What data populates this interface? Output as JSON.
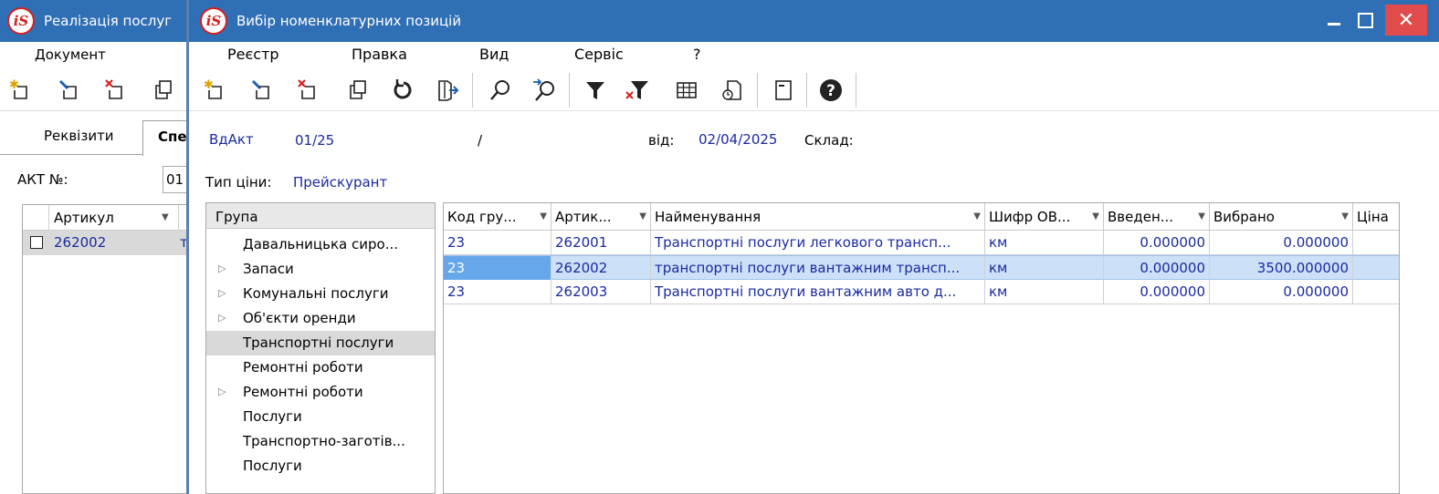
{
  "background_window": {
    "title": "Реалізація послуг",
    "menu_item": "Документ",
    "tabs": [
      "Реквізити",
      "Спе"
    ],
    "akt_label": "АКТ №:",
    "akt_value": "01",
    "grid_header": "Артикул",
    "row_article": "262002",
    "row_extra": "т"
  },
  "dialog": {
    "title": "Вибір номенклатурних позицій",
    "menu": [
      "Реєстр",
      "Правка",
      "Вид",
      "Сервіс",
      "?"
    ],
    "close_glyph": "✕",
    "info": {
      "doc_type": "ВдАкт",
      "doc_number": "01/25",
      "slash": "/",
      "date_label": "від:",
      "date_value": "02/04/2025",
      "warehouse_label": "Склад:",
      "price_type_label": "Тип ціни:",
      "price_type_value": "Прейскурант"
    },
    "groups": {
      "header": "Група",
      "items": [
        {
          "label": "Давальницька сиро...",
          "expandable": false
        },
        {
          "label": "Запаси",
          "expandable": true
        },
        {
          "label": "Комунальні послуги",
          "expandable": true
        },
        {
          "label": "Об'єкти оренди",
          "expandable": true
        },
        {
          "label": "Транспортні послуги",
          "expandable": false,
          "selected": true
        },
        {
          "label": "Ремонтні роботи",
          "expandable": false
        },
        {
          "label": "Ремонтні роботи",
          "expandable": true
        },
        {
          "label": "Послуги",
          "expandable": false
        },
        {
          "label": "Транспортно-заготів...",
          "expandable": false
        },
        {
          "label": "Послуги",
          "expandable": false
        }
      ]
    },
    "grid": {
      "columns": [
        "Код гру...",
        "Артик...",
        "Найменування",
        "Шифр ОВ...",
        "Введен...",
        "Вибрано",
        "Ціна"
      ],
      "rows": [
        {
          "code": "23",
          "article": "262001",
          "name": "Транспортні послуги легкового трансп...",
          "unit": "км",
          "entered": "0.000000",
          "selected": "0.000000",
          "price": ""
        },
        {
          "code": "23",
          "article": "262002",
          "name": "транспортні послуги вантажним трансп...",
          "unit": "км",
          "entered": "0.000000",
          "selected": "3500.000000",
          "price": ""
        },
        {
          "code": "23",
          "article": "262003",
          "name": "Транспортні послуги вантажним авто д...",
          "unit": "км",
          "entered": "0.000000",
          "selected": "0.000000",
          "price": ""
        }
      ]
    }
  },
  "icons": [
    "add-icon",
    "edit-icon",
    "delete-icon",
    "copy-icon",
    "refresh-icon",
    "export-icon",
    "search-icon",
    "search-next-icon",
    "filter-icon",
    "clear-filter-icon",
    "table-icon",
    "history-icon",
    "card-icon",
    "help-icon"
  ],
  "colors": {
    "titlebar": "#2f6fb5",
    "close": "#e14b4b",
    "link_text": "#1a2aa0",
    "selected_row": "#cce1f7"
  }
}
